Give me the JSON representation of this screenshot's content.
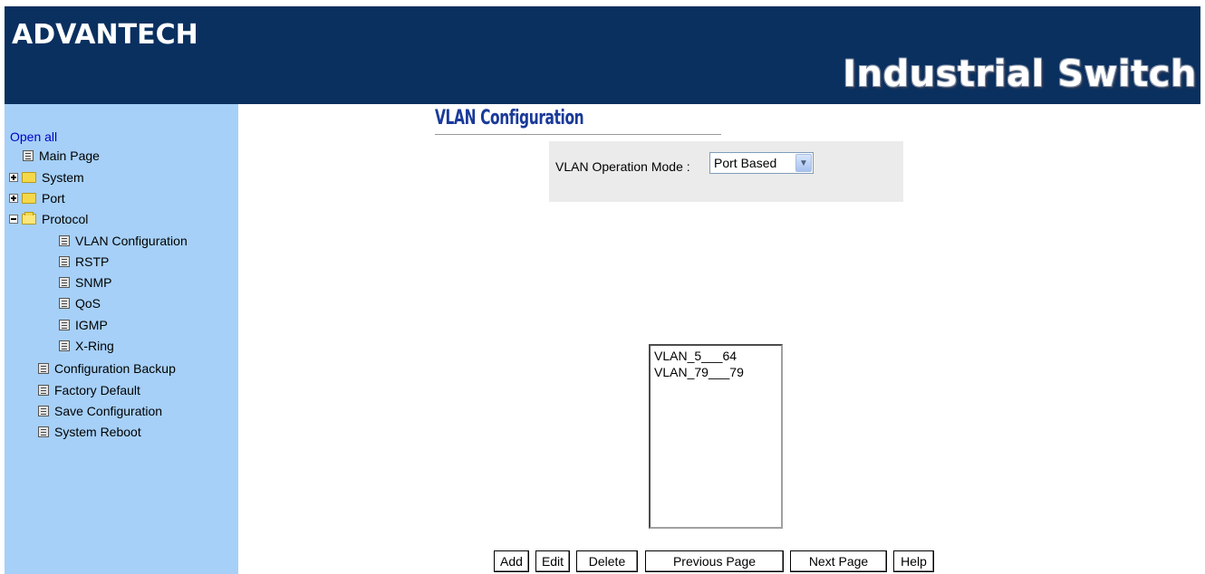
{
  "header": {
    "brand": "ADVANTECH",
    "product": "Industrial Switch",
    "background_color": "#0a3060"
  },
  "sidebar": {
    "open_all": "Open all",
    "background_color": "#a6d0f8",
    "items": [
      {
        "label": "Main Page",
        "icon": "page-icon"
      },
      {
        "label": "System",
        "icon": "folder-icon",
        "expander": "plus"
      },
      {
        "label": "Port",
        "icon": "folder-icon",
        "expander": "plus"
      },
      {
        "label": "Protocol",
        "icon": "folder-open-icon",
        "expander": "minus"
      },
      {
        "label": "VLAN Configuration",
        "icon": "page-icon"
      },
      {
        "label": "RSTP",
        "icon": "page-icon"
      },
      {
        "label": "SNMP",
        "icon": "page-icon"
      },
      {
        "label": "QoS",
        "icon": "page-icon"
      },
      {
        "label": "IGMP",
        "icon": "page-icon"
      },
      {
        "label": "X-Ring",
        "icon": "page-icon"
      },
      {
        "label": "Configuration Backup",
        "icon": "page-icon"
      },
      {
        "label": "Factory Default",
        "icon": "page-icon"
      },
      {
        "label": "Save Configuration",
        "icon": "page-icon"
      },
      {
        "label": "System Reboot",
        "icon": "page-icon"
      }
    ]
  },
  "main": {
    "title": "VLAN Configuration",
    "mode_label": "VLAN Operation Mode :",
    "mode_value": "Port Based",
    "vlan_list": [
      "VLAN_5___64",
      "VLAN_79___79"
    ],
    "buttons": {
      "add": "Add",
      "edit": "Edit",
      "delete": "Delete",
      "previous": "Previous Page",
      "next": "Next Page",
      "help": "Help"
    }
  }
}
